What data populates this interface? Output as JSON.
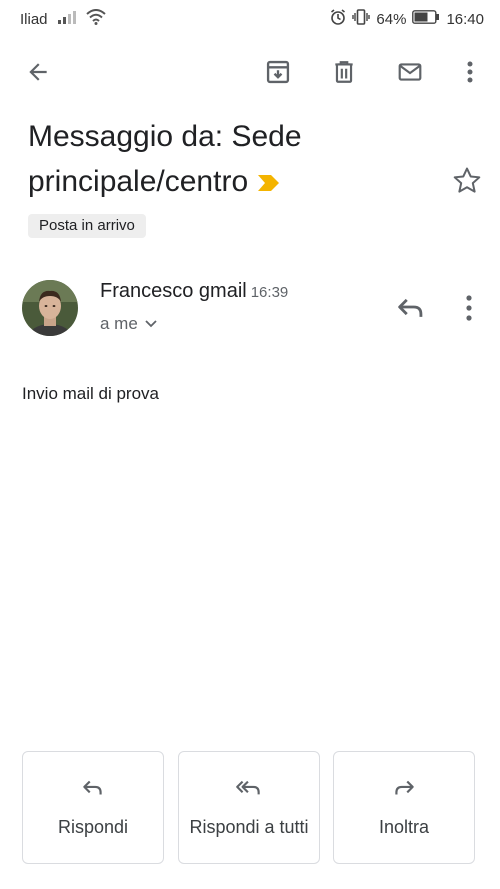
{
  "status_bar": {
    "carrier": "Iliad",
    "battery": "64%",
    "time": "16:40"
  },
  "toolbar": {
    "icons": [
      "back-arrow-icon",
      "archive-icon",
      "delete-icon",
      "mail-icon",
      "more-vert-icon"
    ]
  },
  "email": {
    "subject": "Messaggio da: Sede principale/centro",
    "label": "Posta in arrivo",
    "sender": "Francesco gmail",
    "time": "16:39",
    "recipient": "a me",
    "body": "Invio mail di prova"
  },
  "actions": {
    "reply": "Rispondi",
    "reply_all": "Rispondi a tutti",
    "forward": "Inoltra"
  },
  "colors": {
    "importance_marker": "#f4b400",
    "icon": "#5f6368",
    "chip_bg": "#eeeeee"
  }
}
